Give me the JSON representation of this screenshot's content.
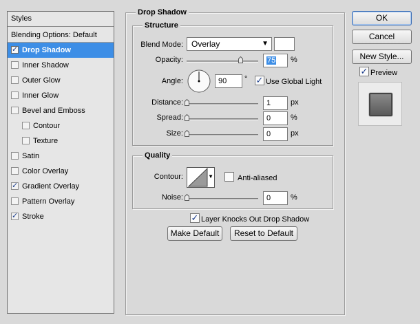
{
  "styles_panel": {
    "header": "Styles",
    "items": [
      {
        "label": "Blending Options: Default",
        "checkbox": false,
        "checked": false,
        "selected": false,
        "sub": false
      },
      {
        "label": "Drop Shadow",
        "checkbox": true,
        "checked": true,
        "selected": true,
        "sub": false
      },
      {
        "label": "Inner Shadow",
        "checkbox": true,
        "checked": false,
        "selected": false,
        "sub": false
      },
      {
        "label": "Outer Glow",
        "checkbox": true,
        "checked": false,
        "selected": false,
        "sub": false
      },
      {
        "label": "Inner Glow",
        "checkbox": true,
        "checked": false,
        "selected": false,
        "sub": false
      },
      {
        "label": "Bevel and Emboss",
        "checkbox": true,
        "checked": false,
        "selected": false,
        "sub": false
      },
      {
        "label": "Contour",
        "checkbox": true,
        "checked": false,
        "selected": false,
        "sub": true
      },
      {
        "label": "Texture",
        "checkbox": true,
        "checked": false,
        "selected": false,
        "sub": true
      },
      {
        "label": "Satin",
        "checkbox": true,
        "checked": false,
        "selected": false,
        "sub": false
      },
      {
        "label": "Color Overlay",
        "checkbox": true,
        "checked": false,
        "selected": false,
        "sub": false
      },
      {
        "label": "Gradient Overlay",
        "checkbox": true,
        "checked": true,
        "selected": false,
        "sub": false
      },
      {
        "label": "Pattern Overlay",
        "checkbox": true,
        "checked": false,
        "selected": false,
        "sub": false
      },
      {
        "label": "Stroke",
        "checkbox": true,
        "checked": true,
        "selected": false,
        "sub": false
      }
    ]
  },
  "drop_shadow": {
    "title": "Drop Shadow",
    "structure": {
      "title": "Structure",
      "blend_mode_label": "Blend Mode:",
      "blend_mode_value": "Overlay",
      "blend_color": "#ffffff",
      "opacity_label": "Opacity:",
      "opacity_value": "75",
      "opacity_unit": "%",
      "opacity_fraction": 0.75,
      "angle_label": "Angle:",
      "angle_value": "90",
      "angle_unit": "°",
      "angle_degrees": 90,
      "use_global_light_label": "Use Global Light",
      "use_global_light_checked": true,
      "distance_label": "Distance:",
      "distance_value": "1",
      "distance_unit": "px",
      "distance_fraction": 0.0,
      "spread_label": "Spread:",
      "spread_value": "0",
      "spread_unit": "%",
      "spread_fraction": 0.0,
      "size_label": "Size:",
      "size_value": "0",
      "size_unit": "px",
      "size_fraction": 0.0
    },
    "quality": {
      "title": "Quality",
      "contour_label": "Contour:",
      "anti_aliased_label": "Anti-aliased",
      "anti_aliased_checked": false,
      "noise_label": "Noise:",
      "noise_value": "0",
      "noise_unit": "%",
      "noise_fraction": 0.0
    },
    "layer_knocks_out_label": "Layer Knocks Out Drop Shadow",
    "layer_knocks_out_checked": true,
    "make_default_label": "Make Default",
    "reset_to_default_label": "Reset to Default"
  },
  "right_buttons": {
    "ok_label": "OK",
    "cancel_label": "Cancel",
    "new_style_label": "New Style...",
    "preview_label": "Preview",
    "preview_checked": true
  },
  "colors": {
    "selection": "#3d8ee6",
    "dialog_bg": "#d9d9d9",
    "check": "#1b3d8c"
  }
}
